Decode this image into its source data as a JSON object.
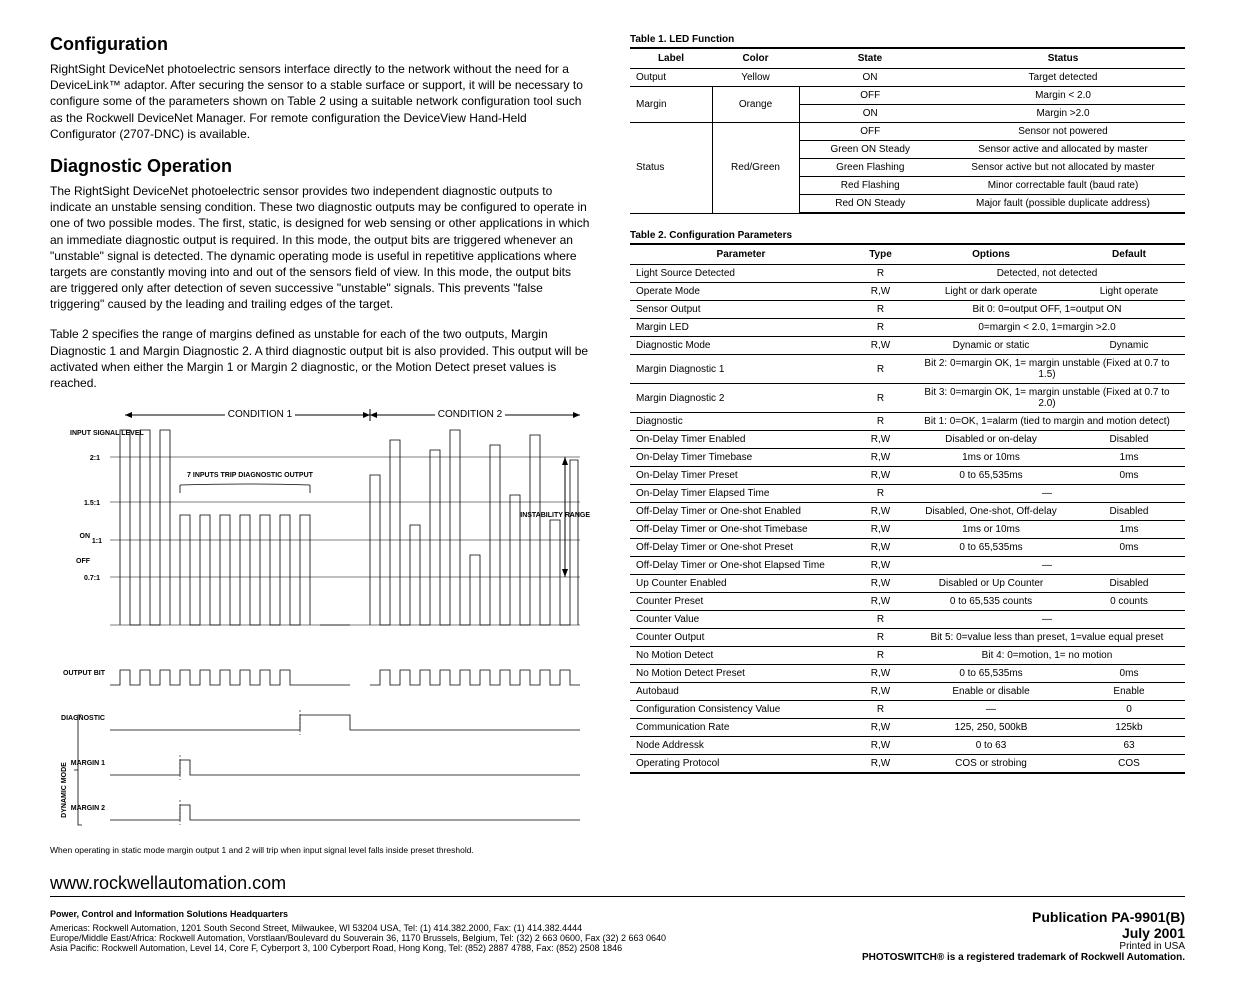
{
  "headings": {
    "configuration": "Configuration",
    "diagnostic": "Diagnostic Operation"
  },
  "paragraphs": {
    "config": "RightSight DeviceNet photoelectric sensors interface directly to the network without the need for a DeviceLink™ adaptor. After securing the sensor to a stable surface or support, it will be necessary to configure some of the parameters shown on Table 2 using a suitable network configuration tool such as the Rockwell DeviceNet Manager. For remote configuration the DeviceView Hand-Held Configurator (2707-DNC) is available.",
    "diag1": "The RightSight DeviceNet photoelectric sensor provides two independent diagnostic outputs to indicate an unstable sensing condition. These two diagnostic outputs may be configured to operate in one of two possible modes. The first, static, is designed for web sensing or other applications in which an immediate diagnostic output is required. In this mode, the output bits are triggered whenever an \"unstable\" signal is detected. The dynamic operating mode is useful in repetitive applications where targets are constantly moving into and out of the sensors field of view. In this mode, the output bits are triggered only after detection of seven successive \"unstable\" signals. This prevents \"false triggering\" caused by the leading and trailing edges of the target.",
    "diag2": "Table 2 specifies the range of margins defined as unstable for each of the two outputs, Margin Diagnostic 1 and Margin Diagnostic 2. A third diagnostic output bit is also provided. This output will be activated when either the Margin 1 or Margin 2 diagnostic, or the Motion Detect preset values is reached."
  },
  "diagram": {
    "condition1": "CONDITION 1",
    "condition2": "CONDITION 2",
    "input_signal_level": "INPUT SIGNAL LEVEL",
    "ratio_21": "2:1",
    "ratio_151": "1.5:1",
    "ratio_11": "1:1",
    "on": "ON",
    "off": "OFF",
    "ratio_071": "0.7:1",
    "seven_inputs": "7 INPUTS TRIP DIAGNOSTIC OUTPUT",
    "instability": "INSTABILITY RANGE",
    "output_bit": "OUTPUT BIT",
    "diagnostic": "DIAGNOSTIC",
    "dynamic_mode": "DYNAMIC MODE",
    "margin1": "MARGIN 1",
    "margin2": "MARGIN 2",
    "note": "When operating in static mode margin output 1 and 2 will trip when input signal level falls inside preset threshold."
  },
  "table1": {
    "caption": "Table 1.  LED Function",
    "headers": [
      "Label",
      "Color",
      "State",
      "Status"
    ],
    "rows": [
      {
        "label": "Output",
        "color": "Yellow",
        "state": "ON",
        "status": "Target detected",
        "lspan": 1,
        "cspan": 1
      },
      {
        "label": "Margin",
        "color": "Orange",
        "state": "OFF",
        "status": "Margin < 2.0",
        "lspan": 2,
        "cspan": 2
      },
      {
        "state": "ON",
        "status": "Margin >2.0"
      },
      {
        "label": "Status",
        "color": "Red/Green",
        "state": "OFF",
        "status": "Sensor not powered",
        "lspan": 5,
        "cspan": 5
      },
      {
        "state": "Green ON Steady",
        "status": "Sensor active and allocated by master"
      },
      {
        "state": "Green Flashing",
        "status": "Sensor active but not allocated by master"
      },
      {
        "state": "Red Flashing",
        "status": "Minor correctable fault (baud rate)"
      },
      {
        "state": "Red ON Steady",
        "status": "Major fault (possible duplicate address)"
      }
    ]
  },
  "table2": {
    "caption": "Table 2.  Configuration Parameters",
    "headers": [
      "Parameter",
      "Type",
      "Options",
      "Default"
    ],
    "rows": [
      [
        "Light Source Detected",
        "R",
        "Detected, not detected",
        ""
      ],
      [
        "Operate Mode",
        "R,W",
        "Light or dark operate",
        "Light operate"
      ],
      [
        "Sensor Output",
        "R",
        "Bit 0: 0=output OFF, 1=output ON",
        ""
      ],
      [
        "Margin LED",
        "R",
        "0=margin < 2.0, 1=margin >2.0",
        ""
      ],
      [
        "Diagnostic Mode",
        "R,W",
        "Dynamic or static",
        "Dynamic"
      ],
      [
        "Margin Diagnostic 1",
        "R",
        "Bit 2: 0=margin OK, 1= margin unstable (Fixed at 0.7 to 1.5)",
        ""
      ],
      [
        "Margin Diagnostic 2",
        "R",
        "Bit 3: 0=margin OK, 1= margin unstable (Fixed at 0.7 to 2.0)",
        ""
      ],
      [
        "Diagnostic",
        "R",
        "Bit 1: 0=OK, 1=alarm (tied to margin and motion detect)",
        ""
      ],
      [
        "On-Delay Timer Enabled",
        "R,W",
        "Disabled or on-delay",
        "Disabled"
      ],
      [
        "On-Delay Timer Timebase",
        "R,W",
        "1ms or 10ms",
        "1ms"
      ],
      [
        "On-Delay Timer Preset",
        "R,W",
        "0 to 65,535ms",
        "0ms"
      ],
      [
        "On-Delay Timer Elapsed Time",
        "R",
        "—",
        ""
      ],
      [
        "Off-Delay Timer or One-shot Enabled",
        "R,W",
        "Disabled, One-shot, Off-delay",
        "Disabled"
      ],
      [
        "Off-Delay Timer or One-shot Timebase",
        "R,W",
        "1ms or 10ms",
        "1ms"
      ],
      [
        "Off-Delay Timer or One-shot Preset",
        "R,W",
        "0 to 65,535ms",
        "0ms"
      ],
      [
        "Off-Delay Timer or One-shot Elapsed Time",
        "R,W",
        "—",
        ""
      ],
      [
        "Up Counter Enabled",
        "R,W",
        "Disabled or Up Counter",
        "Disabled"
      ],
      [
        "Counter Preset",
        "R,W",
        "0 to 65,535 counts",
        "0 counts"
      ],
      [
        "Counter Value",
        "R",
        "—",
        ""
      ],
      [
        "Counter Output",
        "R",
        "Bit 5:  0=value less than preset, 1=value equal preset",
        ""
      ],
      [
        "No Motion Detect",
        "R",
        "Bit 4: 0=motion, 1= no motion",
        ""
      ],
      [
        "No Motion Detect Preset",
        "R,W",
        "0 to 65,535ms",
        "0ms"
      ],
      [
        "Autobaud",
        "R,W",
        "Enable or disable",
        "Enable"
      ],
      [
        "Configuration Consistency Value",
        "R",
        "—",
        "0"
      ],
      [
        "Communication Rate",
        "R,W",
        "125, 250, 500kB",
        "125kb"
      ],
      [
        "Node Addressk",
        "R,W",
        "0 to 63",
        "63"
      ],
      [
        "Operating Protocol",
        "R,W",
        "COS or strobing",
        "COS"
      ]
    ]
  },
  "footer": {
    "url": "www.rockwellautomation.com",
    "hq_title": "Power, Control and Information Solutions Headquarters",
    "americas": "Americas: Rockwell Automation, 1201 South Second Street, Milwaukee, WI 53204 USA, Tel: (1) 414.382.2000, Fax: (1) 414.382.4444",
    "emea": "Europe/Middle East/Africa: Rockwell Automation, Vorstlaan/Boulevard du Souverain 36, 1170 Brussels, Belgium, Tel: (32) 2 663 0600, Fax (32) 2 663 0640",
    "asia": "Asia Pacific: Rockwell Automation, Level 14, Core F, Cyberport 3, 100 Cyberport Road, Hong Kong, Tel: (852) 2887 4788, Fax: (852) 2508 1846",
    "pub_id": "Publication PA-9901(B)",
    "pub_date": "July 2001",
    "printed": "Printed in USA",
    "trademark": "PHOTOSWITCH® is a registered trademark of Rockwell Automation."
  }
}
